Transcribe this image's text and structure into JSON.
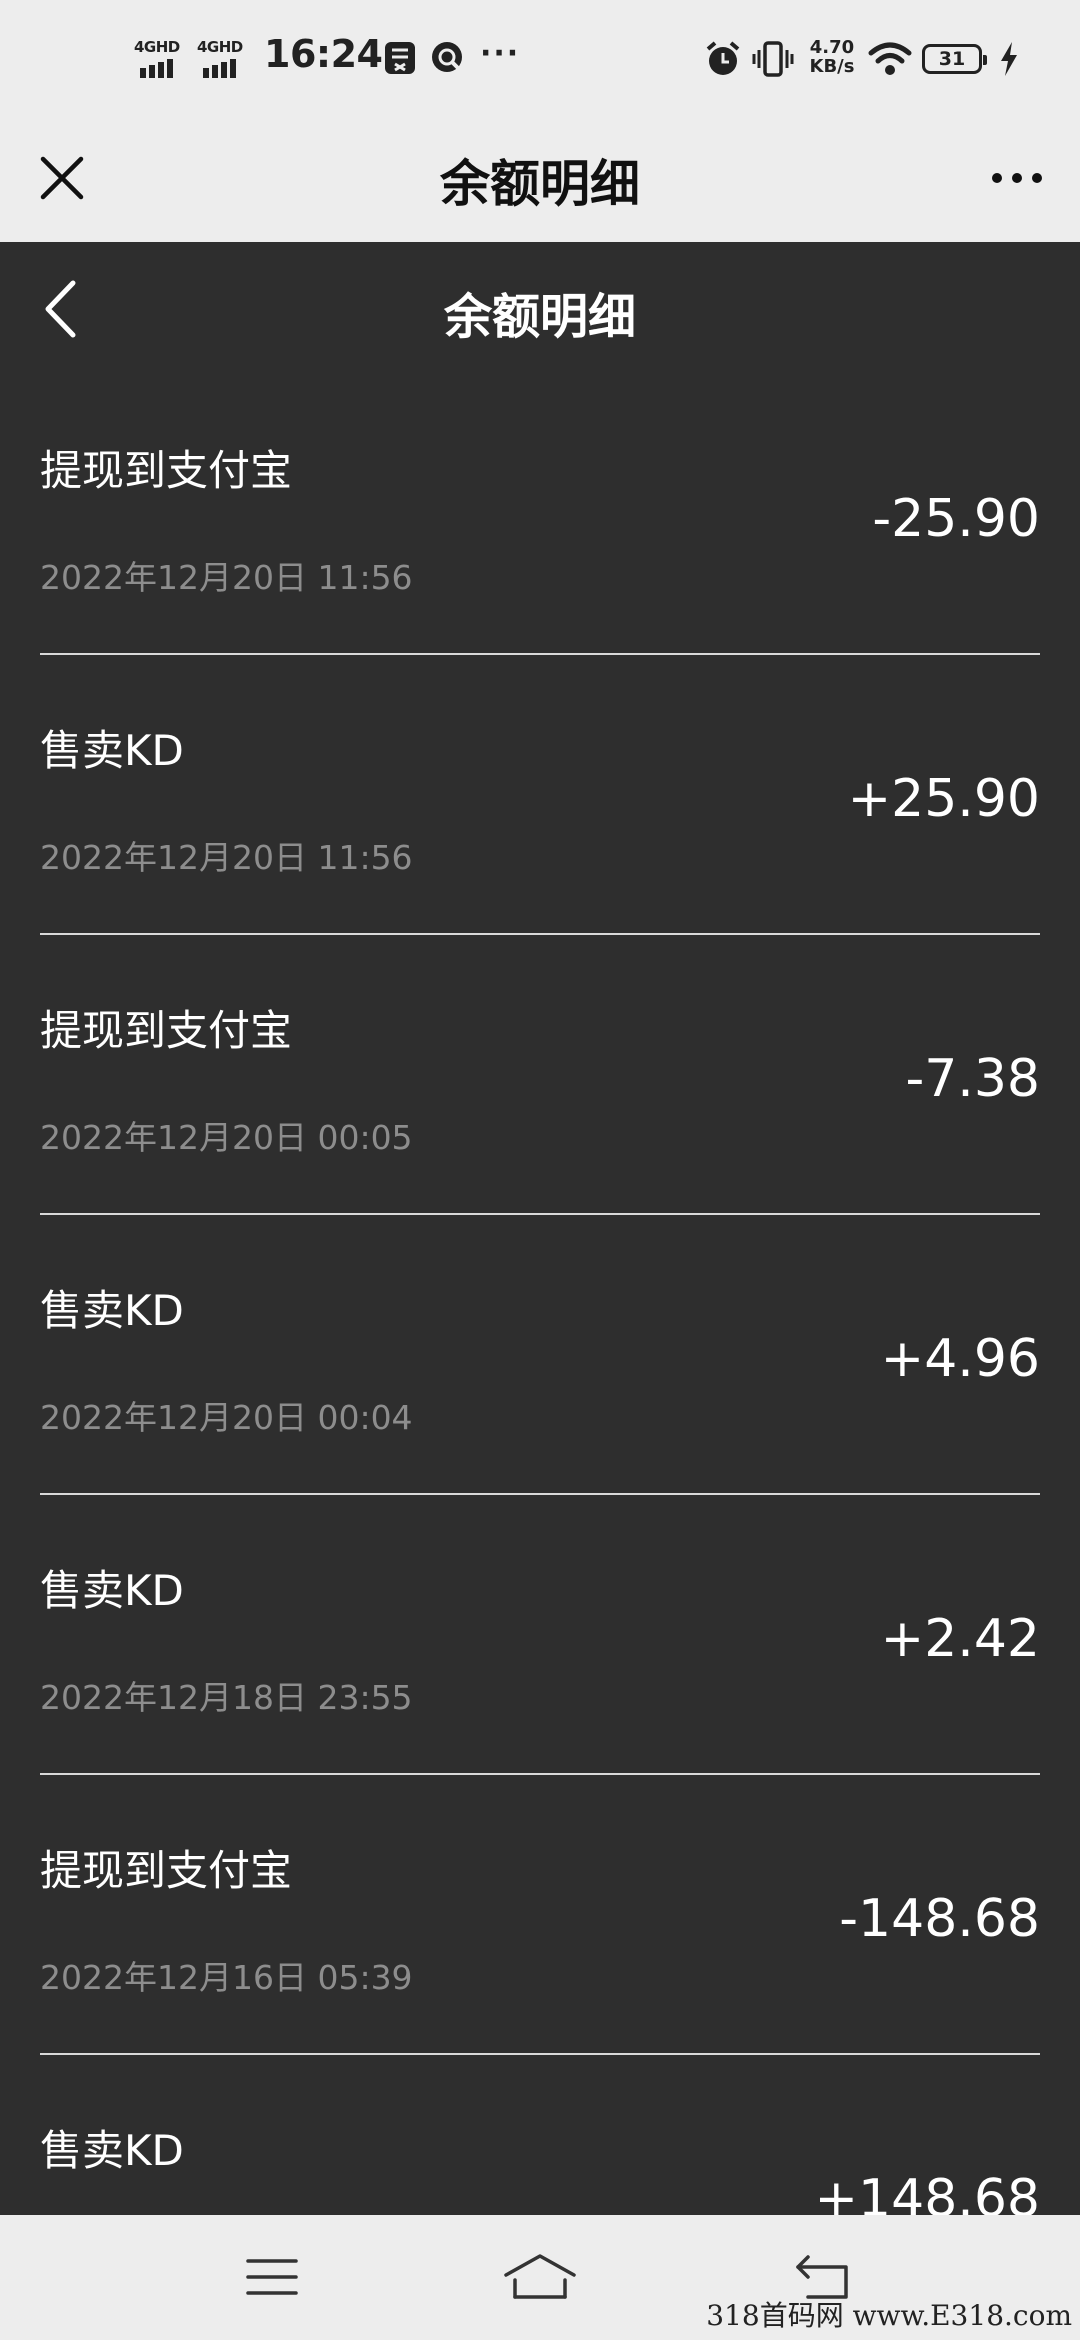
{
  "status_bar": {
    "signal1": "4GHD",
    "signal2": "4GHD",
    "time": "16:24",
    "more": "···",
    "speed_value": "4.70",
    "speed_unit": "KB/s",
    "battery": "31"
  },
  "top_bar": {
    "title": "余额明细"
  },
  "page": {
    "title": "余额明细"
  },
  "transactions": [
    {
      "title": "提现到支付宝",
      "date": "2022年12月20日 11:56",
      "amount": "-25.90"
    },
    {
      "title": "售卖KD",
      "date": "2022年12月20日 11:56",
      "amount": "+25.90"
    },
    {
      "title": "提现到支付宝",
      "date": "2022年12月20日 00:05",
      "amount": "-7.38"
    },
    {
      "title": "售卖KD",
      "date": "2022年12月20日 00:04",
      "amount": "+4.96"
    },
    {
      "title": "售卖KD",
      "date": "2022年12月18日 23:55",
      "amount": "+2.42"
    },
    {
      "title": "提现到支付宝",
      "date": "2022年12月16日 05:39",
      "amount": "-148.68"
    },
    {
      "title": "售卖KD",
      "date": "",
      "amount": "+148.68"
    }
  ],
  "watermark": "318首码网 www.E318.com",
  "icons": {
    "close": "close-icon",
    "more": "more-dots-icon",
    "back": "chevron-left-icon",
    "menu": "menu-lines-icon",
    "home": "home-icon",
    "return": "return-icon"
  }
}
